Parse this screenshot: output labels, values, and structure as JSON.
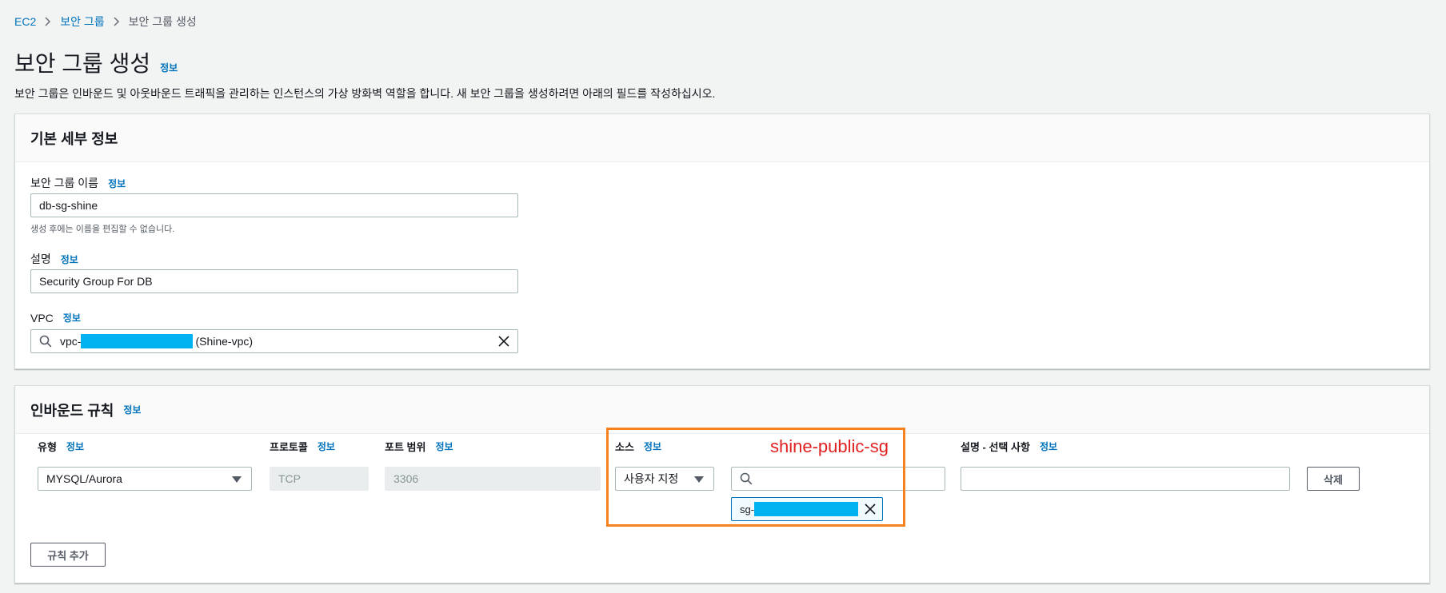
{
  "breadcrumb": {
    "items": [
      "EC2",
      "보안 그룹",
      "보안 그룹 생성"
    ]
  },
  "page": {
    "title": "보안 그룹 생성",
    "info": "정보",
    "description": "보안 그룹은 인바운드 및 아웃바운드 트래픽을 관리하는 인스턴스의 가상 방화벽 역할을 합니다. 새 보안 그룹을 생성하려면 아래의 필드를 작성하십시오."
  },
  "basic": {
    "header": "기본 세부 정보",
    "name_label": "보안 그룹 이름",
    "name_value": "db-sg-shine",
    "name_hint": "생성 후에는 이름을 편집할 수 없습니다.",
    "desc_label": "설명",
    "desc_value": "Security Group For DB",
    "vpc_label": "VPC",
    "vpc_prefix": "vpc-",
    "vpc_suffix": "(Shine-vpc)"
  },
  "inbound": {
    "header": "인바운드 규칙",
    "columns": {
      "type": "유형",
      "protocol": "프로토콜",
      "port": "포트 범위",
      "source": "소스",
      "description": "설명 - 선택 사항"
    },
    "row": {
      "type": "MYSQL/Aurora",
      "protocol": "TCP",
      "port": "3306",
      "source_mode": "사용자 지정",
      "source_search": "",
      "source_token_prefix": "sg-",
      "description": ""
    },
    "delete_label": "삭제",
    "add_rule_label": "규칙 추가",
    "annotation": "shine-public-sg"
  },
  "colors": {
    "link": "#0073bb",
    "highlight": "#f5821f",
    "annotation": "#e02121",
    "redaction": "#00b3f0"
  }
}
